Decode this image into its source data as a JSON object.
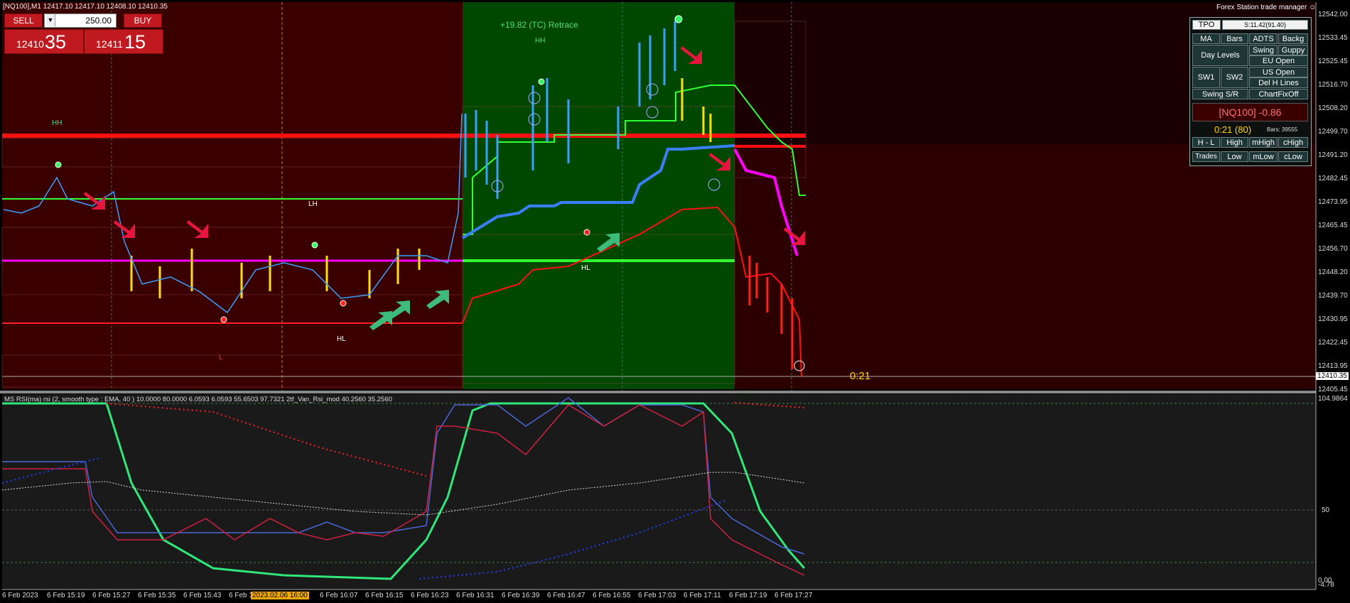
{
  "window": {
    "title": "[NQ100],M1  12417.10 12417.10 12408.10 12410.35",
    "tm_title": "Forex Station trade manager",
    "tm_icon": "smiley-icon"
  },
  "one_click": {
    "sell_label": "SELL",
    "buy_label": "BUY",
    "volume": "250.00",
    "sell_price_small": "12410",
    "sell_price_big": "35",
    "buy_price_small": "12411",
    "buy_price_big": "15"
  },
  "chart_labels": {
    "retrace": "+19.82 (TC) Retrace",
    "hh_left": "HH",
    "hh_mid": "HH",
    "lh": "LH",
    "hl_left": "HL",
    "hl_mid": "HL",
    "l_left": "L",
    "countdown": "0:21",
    "current_price": "12410.35"
  },
  "price_axis": [
    "12542.00",
    "12533.45",
    "12525.45",
    "12516.70",
    "12508.20",
    "12499.70",
    "12491.20",
    "12482.45",
    "12473.95",
    "12465.45",
    "12456.70",
    "12448.20",
    "12439.70",
    "12430.95",
    "12422.45",
    "12413.95",
    "12405.45"
  ],
  "indicator": {
    "caption": "MS RSI(ma) rsi (2, smooth type : EMA, 40 ) 10.0000 80.0000 6.0593 6.0593 55.6503 97.7321  2tf_Van_Rsi_mod 40.2560 35.2560",
    "axis_top": "104.9864",
    "axis_mid": "50",
    "axis_bottom_a": "0.00",
    "axis_bottom_b": "-4.78"
  },
  "time_axis": [
    "6 Feb 2023",
    "6 Feb 15:19",
    "6 Feb 15:27",
    "6 Feb 15:35",
    "6 Feb 15:43",
    "6 Feb 1",
    "6 Feb 16:07",
    "6 Feb 16:15",
    "6 Feb 16:23",
    "6 Feb 16:31",
    "6 Feb 16:39",
    "6 Feb 16:47",
    "6 Feb 16:55",
    "6 Feb 17:03",
    "6 Feb 17:11",
    "6 Feb 17:19",
    "6 Feb 17:27"
  ],
  "time_highlight": "2023.02.06 16:00",
  "trade_manager": {
    "tpo": "TPO",
    "spread": "S:11.42(91.40)",
    "row1": [
      "MA",
      "Bars",
      "ADTS",
      "Backg"
    ],
    "day_levels": "Day Levels",
    "swing": "Swing",
    "guppy": "Guppy",
    "eu_open": "EU Open",
    "sw1": "SW1",
    "sw2": "SW2",
    "us_open": "US Open",
    "del_h_lines": "Del H Lines",
    "swing_sr": "Swing S/R",
    "chart_fix": "ChartFixOff",
    "symbol_change": "[NQ100] -0.86",
    "timer": "0:21 (80)",
    "bars": "Bars: 39555",
    "row_hl": [
      "H - L",
      "High",
      "mHigh",
      "cHigh"
    ],
    "row_tr": [
      "Trades",
      "Low",
      "mLow",
      "cLow"
    ]
  },
  "colors": {
    "bg_bear": "#3a0000",
    "bg_bull": "#004800",
    "red_line": "#ff1010",
    "magenta_line": "#ff00ff",
    "green_line": "#30ff30",
    "blue_line": "#3a7fff",
    "panel_bg": "#1a1a1a"
  }
}
